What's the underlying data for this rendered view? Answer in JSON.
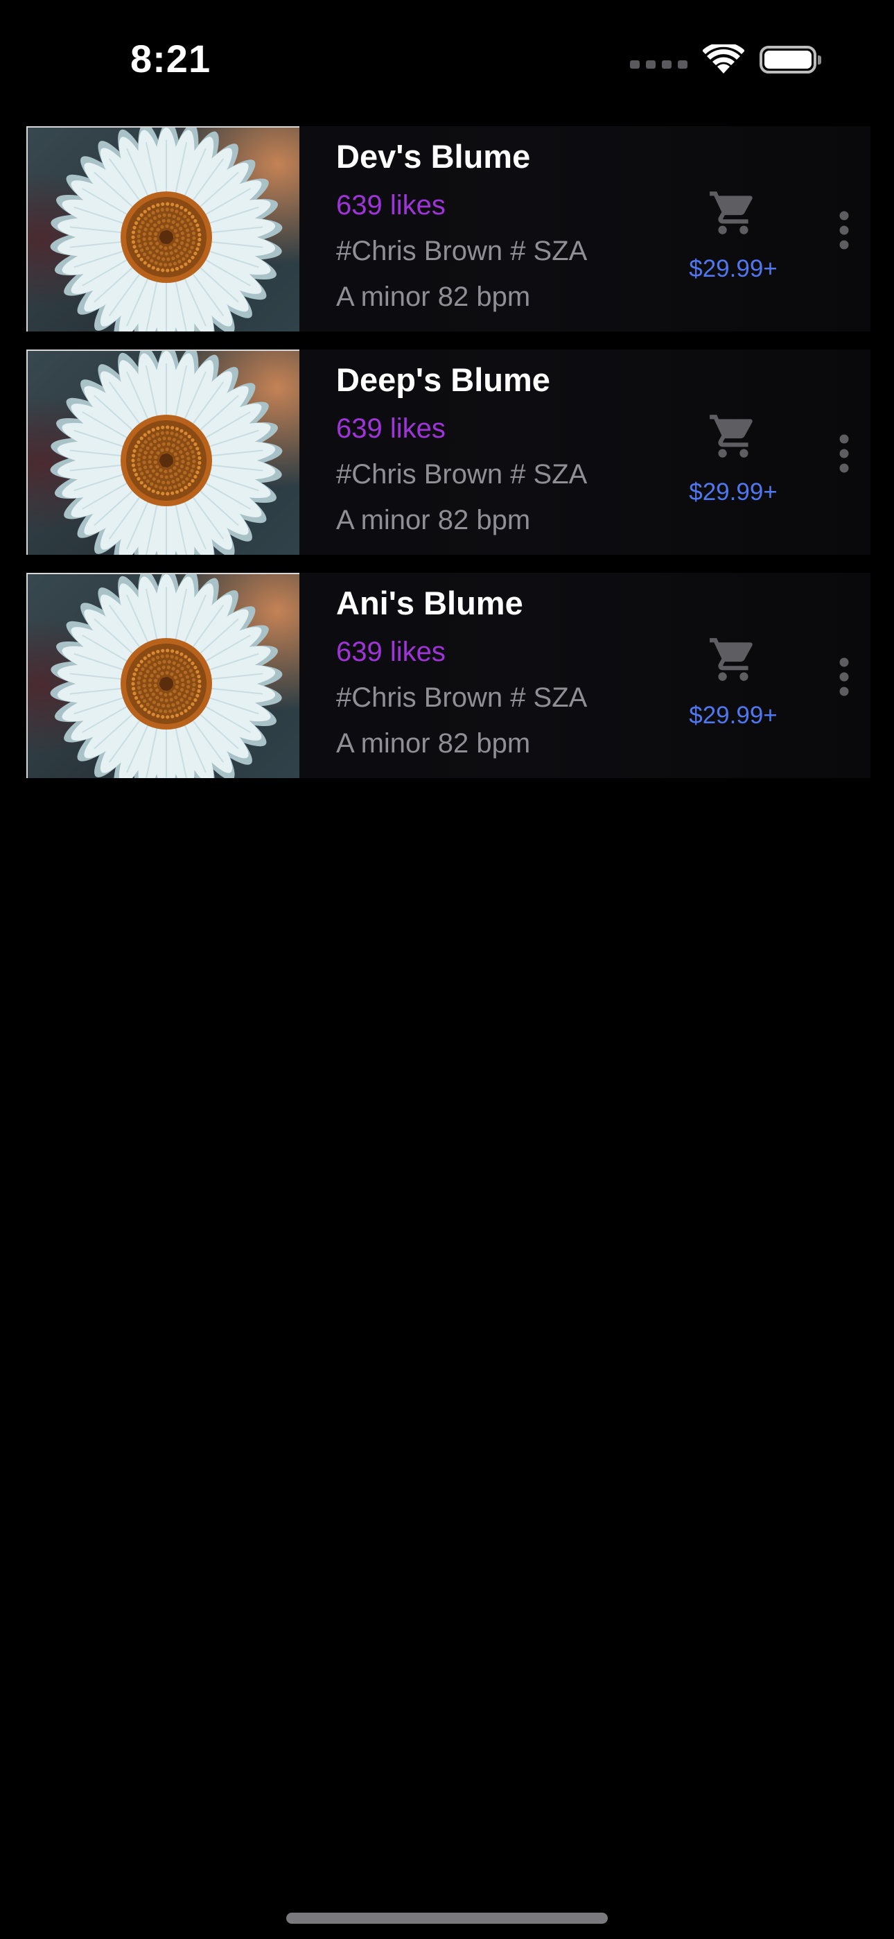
{
  "status_bar": {
    "time": "8:21",
    "icons": [
      "cellular-signal-icon",
      "wifi-icon",
      "battery-icon"
    ]
  },
  "colors": {
    "background": "#000000",
    "likes": "#a033d9",
    "price": "#4f78f0",
    "secondary_text": "#8f8f95",
    "icon_gray": "#5d5d62"
  },
  "tracks": [
    {
      "title": "Dev's Blume",
      "likes": "639 likes",
      "tags": "#Chris Brown # SZA",
      "meta": "A minor 82 bpm",
      "price": "$29.99+",
      "artwork": "daisy-flower-image"
    },
    {
      "title": "Deep's Blume",
      "likes": "639 likes",
      "tags": "#Chris Brown # SZA",
      "meta": "A minor 82 bpm",
      "price": "$29.99+",
      "artwork": "daisy-flower-image"
    },
    {
      "title": "Ani's Blume",
      "likes": "639 likes",
      "tags": "#Chris Brown # SZA",
      "meta": "A minor 82 bpm",
      "price": "$29.99+",
      "artwork": "daisy-flower-image"
    }
  ]
}
